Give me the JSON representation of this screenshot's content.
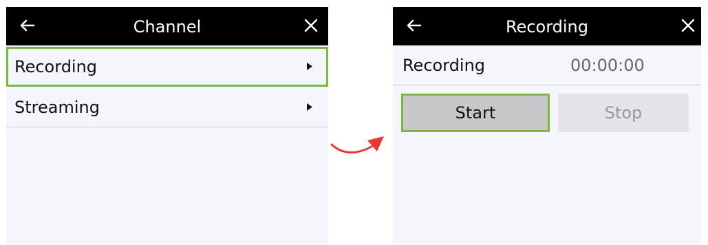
{
  "left_screen": {
    "title": "Channel",
    "menu_items": [
      {
        "label": "Recording",
        "focused": true
      },
      {
        "label": "Streaming",
        "focused": false
      }
    ]
  },
  "right_screen": {
    "title": "Recording",
    "status_label": "Recording",
    "elapsed_time": "00:00:00",
    "start_label": "Start",
    "stop_label": "Stop"
  },
  "icons": {
    "back": "arrow-left-icon",
    "close": "close-icon",
    "submenu": "caret-right-icon",
    "transition": "curved-arrow-icon"
  },
  "colors": {
    "titlebar": "#000000",
    "screen_background": "#f5f5fc",
    "focus_outline": "#7ab648",
    "transition_arrow": "#e53935",
    "disabled_text": "#999999"
  }
}
